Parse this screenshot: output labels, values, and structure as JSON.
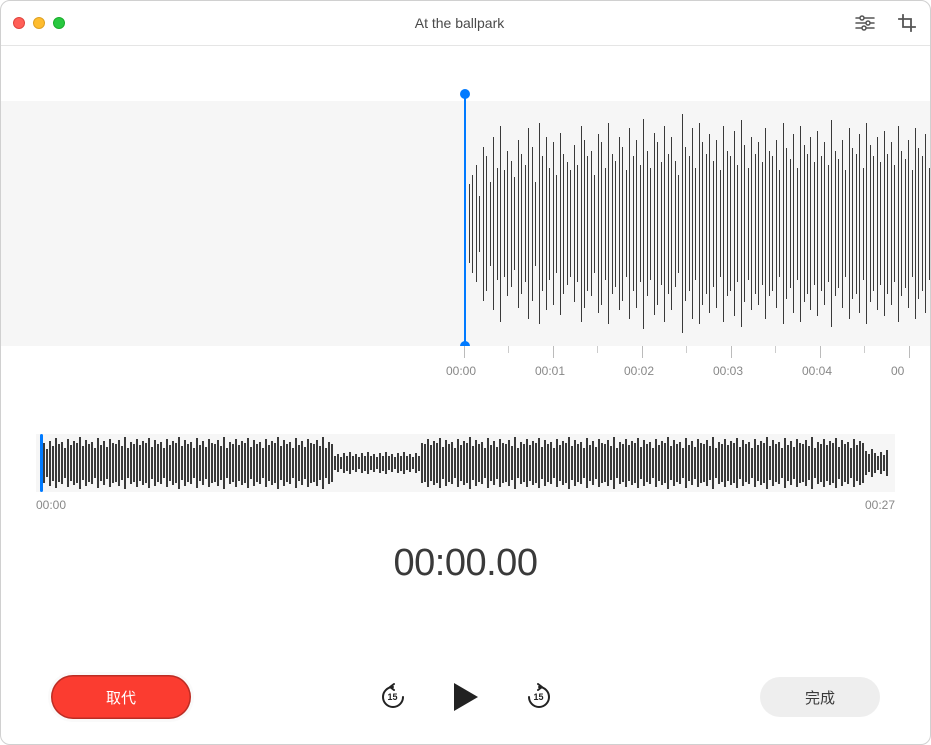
{
  "window": {
    "title": "At the ballpark"
  },
  "time_ruler": [
    "00:00",
    "00:01",
    "00:02",
    "00:03",
    "00:04",
    "00"
  ],
  "overview": {
    "start": "00:00",
    "end": "00:27"
  },
  "current_time": "00:00.00",
  "buttons": {
    "replace": "取代",
    "done": "完成"
  },
  "skip_seconds": "15",
  "waveform_large": [
    28,
    35,
    42,
    20,
    55,
    48,
    30,
    62,
    40,
    70,
    38,
    52,
    45,
    33,
    60,
    50,
    42,
    68,
    55,
    30,
    72,
    48,
    62,
    40,
    58,
    35,
    65,
    50,
    44,
    38,
    56,
    42,
    70,
    60,
    48,
    52,
    35,
    64,
    58,
    40,
    72,
    50,
    45,
    62,
    55,
    38,
    68,
    48,
    60,
    42,
    75,
    52,
    40,
    65,
    58,
    44,
    70,
    50,
    62,
    45,
    35,
    78,
    55,
    48,
    68,
    40,
    72,
    58,
    50,
    64,
    45,
    60,
    38,
    70,
    52,
    48,
    66,
    42,
    74,
    56,
    40,
    62,
    50,
    58,
    44,
    68,
    52,
    48,
    60,
    38,
    72,
    54,
    46,
    64,
    40,
    70,
    56,
    50,
    62,
    44,
    66,
    48,
    58,
    42,
    74,
    52,
    46,
    60,
    38,
    68,
    54,
    50,
    64,
    40,
    72,
    56,
    48,
    62,
    44,
    66,
    50,
    58,
    42,
    70,
    52,
    46,
    60,
    38,
    68,
    54,
    48,
    64,
    40
  ],
  "waveform_overview": [
    32,
    40,
    28,
    45,
    35,
    50,
    38,
    42,
    30,
    48,
    36,
    44,
    40,
    52,
    34,
    46,
    38,
    42,
    30,
    50,
    36,
    44,
    32,
    48,
    40,
    38,
    46,
    34,
    52,
    30,
    42,
    38,
    48,
    36,
    44,
    40,
    50,
    32,
    46,
    38,
    42,
    30,
    48,
    36,
    44,
    40,
    52,
    34,
    46,
    38,
    42,
    30,
    50,
    36,
    44,
    32,
    48,
    40,
    38,
    46,
    34,
    52,
    30,
    42,
    38,
    48,
    36,
    44,
    40,
    50,
    32,
    46,
    38,
    42,
    30,
    48,
    36,
    44,
    40,
    52,
    34,
    46,
    38,
    42,
    30,
    50,
    36,
    44,
    32,
    48,
    40,
    38,
    46,
    34,
    52,
    30,
    42,
    38,
    14,
    18,
    12,
    20,
    15,
    22,
    14,
    18,
    12,
    20,
    15,
    22,
    14,
    18,
    12,
    20,
    15,
    22,
    14,
    18,
    12,
    20,
    15,
    22,
    14,
    18,
    12,
    20,
    15,
    40,
    38,
    48,
    36,
    44,
    40,
    50,
    32,
    46,
    38,
    42,
    30,
    48,
    36,
    44,
    40,
    52,
    34,
    46,
    38,
    42,
    30,
    50,
    36,
    44,
    32,
    48,
    40,
    38,
    46,
    34,
    52,
    30,
    42,
    38,
    48,
    36,
    44,
    40,
    50,
    32,
    46,
    38,
    42,
    30,
    48,
    36,
    44,
    40,
    52,
    34,
    46,
    38,
    42,
    30,
    50,
    36,
    44,
    32,
    48,
    40,
    38,
    46,
    34,
    52,
    30,
    42,
    38,
    48,
    36,
    44,
    40,
    50,
    32,
    46,
    38,
    42,
    30,
    48,
    36,
    44,
    40,
    52,
    34,
    46,
    38,
    42,
    30,
    50,
    36,
    44,
    32,
    48,
    40,
    38,
    46,
    34,
    52,
    30,
    42,
    38,
    48,
    36,
    44,
    40,
    50,
    32,
    46,
    38,
    42,
    30,
    48,
    36,
    44,
    40,
    52,
    34,
    46,
    38,
    42,
    30,
    50,
    36,
    44,
    32,
    48,
    40,
    38,
    46,
    34,
    52,
    30,
    42,
    38,
    48,
    36,
    44,
    40,
    50,
    32,
    46,
    38,
    42,
    30,
    48,
    36,
    44,
    40,
    24,
    18,
    28,
    20,
    14,
    22,
    16,
    26
  ]
}
